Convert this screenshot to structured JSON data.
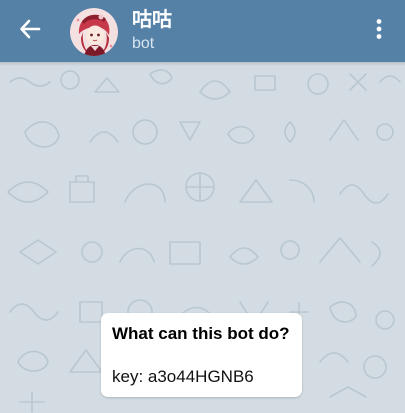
{
  "header": {
    "title": "咕咕",
    "subtitle": "bot",
    "back_icon": "arrow-left-icon",
    "menu_icon": "more-vertical-icon",
    "background_color": "#5681a7"
  },
  "chat": {
    "background_color": "#d2dce2",
    "doodle_color": "#b7c6d0"
  },
  "bot_info": {
    "heading": "What can this bot do?",
    "body": "key: a3o44HGNB6"
  }
}
